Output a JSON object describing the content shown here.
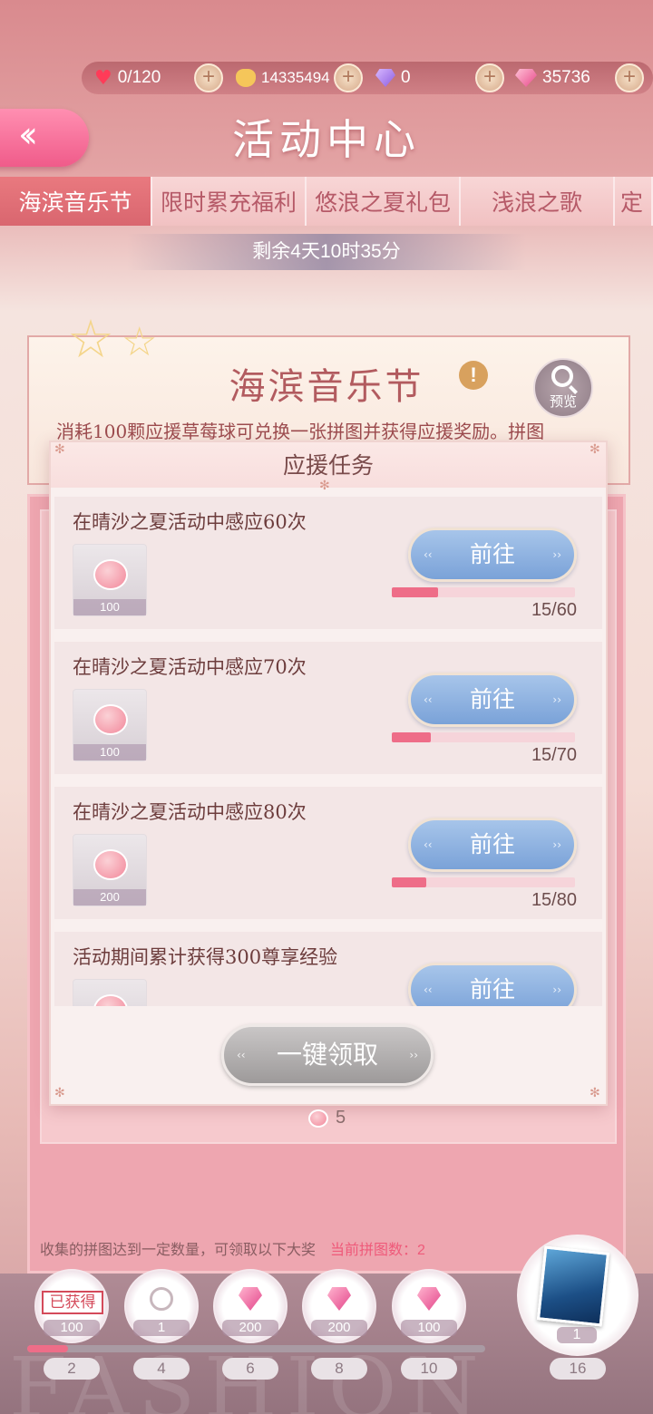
{
  "currency": {
    "stamina": "0/120",
    "gold": "14335494",
    "diamond_purple": "0",
    "diamond_pink": "35736"
  },
  "header": {
    "title": "活动中心"
  },
  "tabs": [
    {
      "label": "海滨音乐节",
      "active": true
    },
    {
      "label": "限时累充福利",
      "active": false
    },
    {
      "label": "悠浪之夏礼包",
      "active": false
    },
    {
      "label": "浅浪之歌",
      "active": false
    },
    {
      "label": "定",
      "active": false
    }
  ],
  "timer": "剩余4天10时35分",
  "event": {
    "title": "海滨音乐节",
    "preview_label": "预览",
    "description": "消耗100颗应援草莓球可兑换一张拼图并获得应援奖励。拼图"
  },
  "modal": {
    "title": "应援任务",
    "go_label": "前往",
    "tasks": [
      {
        "name": "在晴沙之夏活动中感应60次",
        "reward_qty": "100",
        "progress": "15/60",
        "fraction": 0.25
      },
      {
        "name": "在晴沙之夏活动中感应70次",
        "reward_qty": "100",
        "progress": "15/70",
        "fraction": 0.214
      },
      {
        "name": "在晴沙之夏活动中感应80次",
        "reward_qty": "200",
        "progress": "15/80",
        "fraction": 0.188
      },
      {
        "name": "活动期间累计获得300尊享经验",
        "reward_qty": "",
        "progress": "",
        "fraction": 0
      }
    ],
    "claim_all_label": "一键领取"
  },
  "ball_count": "5",
  "collect": {
    "note": "收集的拼图达到一定数量，可领取以下大奖",
    "current": "当前拼图数：2"
  },
  "track": {
    "fill_fraction": 0.09,
    "nodes": [
      {
        "qty": "100",
        "step": "2",
        "icon": "obtained-stamp",
        "stamp": "已获得"
      },
      {
        "qty": "1",
        "step": "4",
        "icon": "bow-icon"
      },
      {
        "qty": "200",
        "step": "6",
        "icon": "pink-diamond-icon"
      },
      {
        "qty": "200",
        "step": "8",
        "icon": "pink-diamond-icon"
      },
      {
        "qty": "100",
        "step": "10",
        "icon": "pink-diamond-icon"
      }
    ],
    "final": {
      "qty": "1",
      "step": "16",
      "icon": "puzzle-picture"
    }
  },
  "watermark": "FASHION",
  "colors": {
    "accent_pink": "#ee6d88",
    "button_blue": "#7aa2d8",
    "active_tab": "#d9666f"
  }
}
